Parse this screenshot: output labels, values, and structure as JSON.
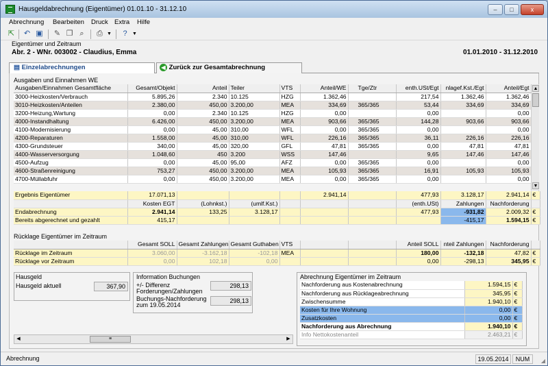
{
  "window": {
    "title": "Hausgeldabrechnung (Eigentümer) 01.01.10 - 31.12.10",
    "min": "–",
    "max": "□",
    "close": "x"
  },
  "menu": [
    "Abrechnung",
    "Bearbeiten",
    "Druck",
    "Extra",
    "Hilfe"
  ],
  "header": {
    "label": "Eigentümer und Zeitraum",
    "name": "Abr. 2 - WNr. 003002 - Claudius, Emma",
    "period": "01.01.2010 - 31.12.2010"
  },
  "tabs": {
    "active": "Einzelabrechnungen",
    "back": "Zurück zur Gesamtabrechnung"
  },
  "main": {
    "section": "Ausgaben und Einnahmen WE",
    "headers": [
      "Ausgaben/Einnahmen Gesamtfläche",
      "Gesamt/Objekt",
      "Anteil",
      "Teiler",
      "VTS",
      "Anteil/WE",
      "Tge/Ztr",
      "enth.USt/Egt",
      "nlagef.Kst./Egt",
      "Anteil/Egt"
    ],
    "rows": [
      [
        "3000-Heizkosten/Verbrauch",
        "5.895,26",
        "2.340",
        "10.125",
        "HZG",
        "1.362,46",
        "",
        "217,54",
        "1.362,46",
        "1.362,46"
      ],
      [
        "3010-Heizkosten/Anteilen",
        "2.380,00",
        "450,00",
        "3.200,00",
        "MEA",
        "334,69",
        "365/365",
        "53,44",
        "334,69",
        "334,69"
      ],
      [
        "3200-Heizung,Wartung",
        "0,00",
        "2.340",
        "10.125",
        "HZG",
        "0,00",
        "",
        "0,00",
        "",
        "0,00"
      ],
      [
        "4000-Instandhaltung",
        "6.426,00",
        "450,00",
        "3.200,00",
        "MEA",
        "903,66",
        "365/365",
        "144,28",
        "903,66",
        "903,66"
      ],
      [
        "4100-Modernisierung",
        "0,00",
        "45,00",
        "310,00",
        "WFL",
        "0,00",
        "365/365",
        "0,00",
        "",
        "0,00"
      ],
      [
        "4200-Reparaturen",
        "1.558,00",
        "45,00",
        "310,00",
        "WFL",
        "226,16",
        "365/365",
        "36,11",
        "226,16",
        "226,16"
      ],
      [
        "4300-Grundsteuer",
        "340,00",
        "45,00",
        "320,00",
        "GFL",
        "47,81",
        "365/365",
        "0,00",
        "47,81",
        "47,81"
      ],
      [
        "4400-Wasserversorgung",
        "1.048,60",
        "450",
        "3.200",
        "WSS",
        "147,46",
        "",
        "9,65",
        "147,46",
        "147,46"
      ],
      [
        "4500-Aufzug",
        "0,00",
        "45,00",
        "95,00",
        "AFZ",
        "0,00",
        "365/365",
        "0,00",
        "",
        "0,00"
      ],
      [
        "4600-Straßenreinigung",
        "753,27",
        "450,00",
        "3.200,00",
        "MEA",
        "105,93",
        "365/365",
        "16,91",
        "105,93",
        "105,93"
      ],
      [
        "4700-Müllabfuhr",
        "0,00",
        "450,00",
        "3.200,00",
        "MEA",
        "0,00",
        "365/365",
        "0,00",
        "",
        "0,00"
      ]
    ],
    "result": {
      "label": "Ergebnis Eigentümer",
      "total": "17.071,13",
      "anteil": "2.941,14",
      "ust": "477,93",
      "kst": "3.128,17",
      "egt": "2.941,14",
      "cur": "€"
    },
    "summary_headers": [
      "Kosten EGT",
      "(Lohnkst.)",
      "(umlf.Kst.)",
      "(enth.USt)",
      "Zahlungen",
      "Nachforderung"
    ],
    "endabrechnung": {
      "label": "Endabrechnung",
      "kosten": "2.941,14",
      "lohn": "133,25",
      "umlf": "3.128,17",
      "ust": "477,93",
      "zahl": "-931,82",
      "nach": "2.009,32",
      "cur": "€"
    },
    "bereits": {
      "label": "Bereits abgerechnet und gezahlt",
      "kosten": "415,17",
      "zahl": "-415,17",
      "nach": "1.594,15",
      "cur": "€"
    }
  },
  "ruecklage": {
    "section": "Rücklage Eigentümer im Zeitraum",
    "headers": [
      "Gesamt SOLL",
      "Gesamt Zahlungen",
      "Gesamt Guthaben",
      "VTS",
      "Anteil SOLL",
      "nteil Zahlungen",
      "Nachforderung"
    ],
    "rows": [
      [
        "Rücklage im Zeitraum",
        "3.060,00",
        "-3.162,18",
        "-102,18",
        "MEA",
        "180,00",
        "-132,18",
        "47,82",
        "€"
      ],
      [
        "Rücklage vor Zeitraum",
        "0,00",
        "102,18",
        "0,00",
        "",
        "0,00",
        "-298,13",
        "345,95",
        "€"
      ]
    ]
  },
  "hausgeld": {
    "section": "Hausgeld",
    "label": "Hausgeld aktuell",
    "value": "367,90"
  },
  "info": {
    "section": "Information Buchungen",
    "l1a": "+/- Differenz",
    "l1b": "Forderungen/Zahlungen",
    "v1": "298,13",
    "l2a": "Buchungs-Nachforderung",
    "l2b": "zum 19.05.2014",
    "v2": "298,13"
  },
  "abrechnung": {
    "section": "Abrechnung Eigentümer im Zeitraum",
    "rows": [
      [
        "Nachforderung aus Kostenabrechnung",
        "1.594,15",
        "€"
      ],
      [
        "Nachforderung aus Rücklageabrechnung",
        "345,95",
        "€"
      ],
      [
        "Zwischensumme",
        "1.940,10",
        "€"
      ],
      [
        "Kosten für Ihre Wohnung",
        "0,00",
        "€"
      ],
      [
        "Zusatzkosten",
        "0,00",
        "€"
      ],
      [
        "Nachforderung aus Abrechnung",
        "1.940,10",
        "€"
      ],
      [
        "Info Nettokostenanteil",
        "2.463,21",
        "€"
      ]
    ]
  },
  "status": {
    "text": "Abrechnung",
    "date": "19.05.2014",
    "num": "NUM"
  }
}
